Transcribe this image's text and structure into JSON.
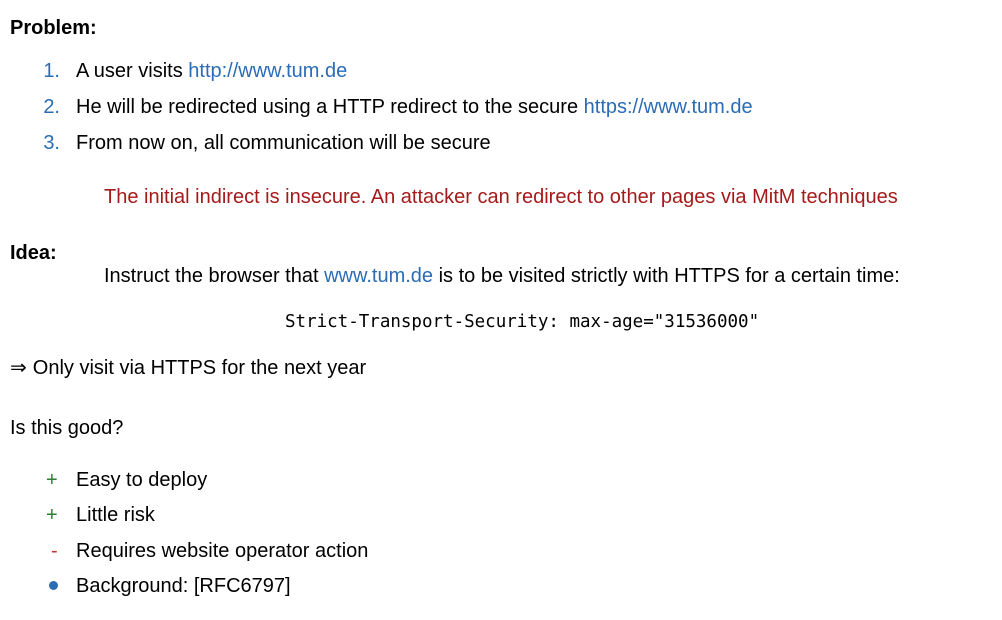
{
  "problem": {
    "heading": "Problem:",
    "steps": [
      {
        "num": "1.",
        "text_before": "A user visits ",
        "link": "http://www.tum.de",
        "text_after": ""
      },
      {
        "num": "2.",
        "text_before": "He will be redirected using a HTTP redirect to the secure ",
        "link": "https://www.tum.de",
        "text_after": ""
      },
      {
        "num": "3.",
        "text_before": "From now on, all communication will be secure",
        "link": "",
        "text_after": ""
      }
    ],
    "warning": "The initial indirect is insecure. An attacker can redirect to other pages via MitM techniques"
  },
  "idea": {
    "heading": "Idea:",
    "text_before": "Instruct the browser that ",
    "link": "www.tum.de",
    "text_after": " is to be visited strictly with HTTPS for a certain time:",
    "header_code": "Strict-Transport-Security: max-age=\"31536000\""
  },
  "conclusion": {
    "arrow": "⇒",
    "text": "Only visit via HTTPS for the next year"
  },
  "question": "Is this good?",
  "evaluation": [
    {
      "marker": "+",
      "kind": "pro",
      "text": "Easy to deploy"
    },
    {
      "marker": "+",
      "kind": "pro",
      "text": "Little risk"
    },
    {
      "marker": "-",
      "kind": "con",
      "text": "Requires website operator action"
    },
    {
      "marker": "",
      "kind": "info",
      "text": "Background: [RFC6797]"
    }
  ],
  "colors": {
    "link": "#2b6cb5",
    "warning": "#a51a1a",
    "pro": "#2e7d32",
    "con": "#c0392b"
  }
}
